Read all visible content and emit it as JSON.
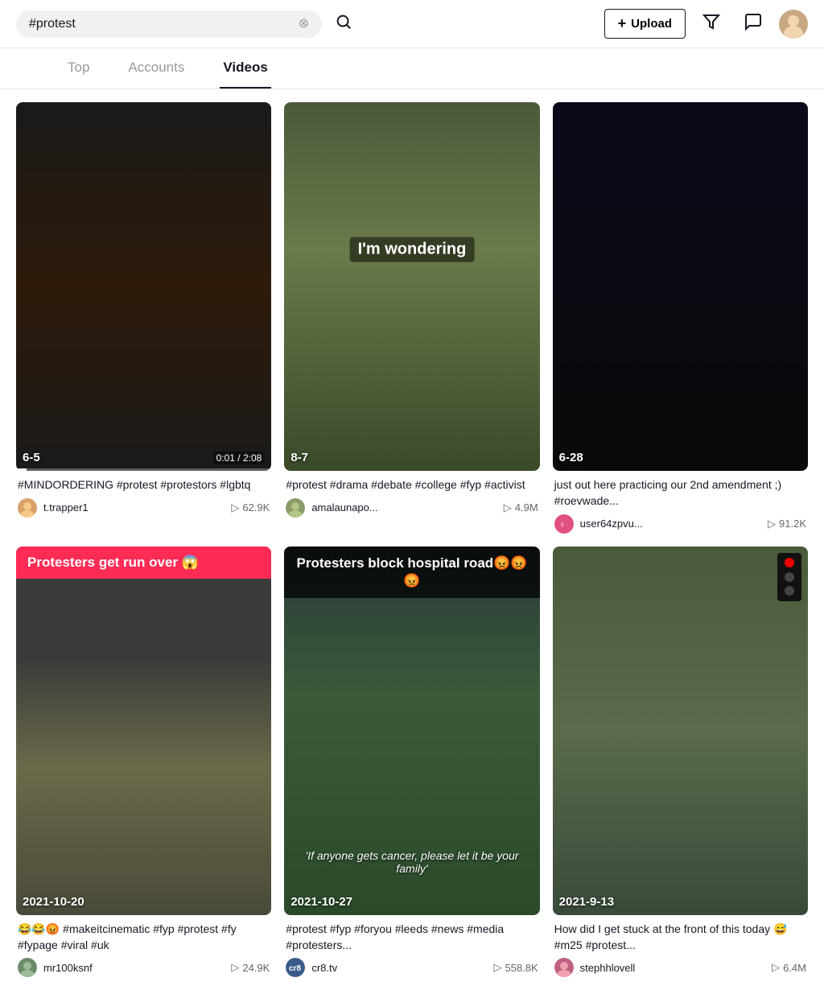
{
  "header": {
    "search_value": "#protest",
    "search_placeholder": "Search",
    "upload_label": "Upload",
    "clear_title": "Clear"
  },
  "tabs": [
    {
      "id": "top",
      "label": "Top",
      "active": false
    },
    {
      "id": "accounts",
      "label": "Accounts",
      "active": false
    },
    {
      "id": "videos",
      "label": "Videos",
      "active": true
    }
  ],
  "videos": [
    {
      "id": 1,
      "thumb_label": "6-5",
      "duration": "0:01 / 2:08",
      "title": "#MINDORDERING #protest #protestors #lgbtq",
      "username": "t.trapper1",
      "play_count": "62.9K",
      "type": "normal"
    },
    {
      "id": 2,
      "thumb_label": "8-7",
      "overlay_text": "I'm wondering",
      "title": "#protest #drama #debate #college #fyp #activist",
      "username": "amalaunapo...",
      "play_count": "4.9M",
      "type": "wondering"
    },
    {
      "id": 3,
      "thumb_label": "6-28",
      "title": "just out here practicing our 2nd amendment ;) #roevwade...",
      "username": "user64zpvu...",
      "play_count": "91.2K",
      "type": "dark"
    },
    {
      "id": 4,
      "red_banner": "Protesters get run over 😱",
      "date_label": "2021-10-20",
      "title": "😂😂😡 #makeitcinematic #fyp #protest #fy #fypage #viral #uk",
      "username": "mr100ksnf",
      "play_count": "24.9K",
      "type": "red_banner"
    },
    {
      "id": 5,
      "hospital_banner": "Protesters block hospital road😡😡😡",
      "date_label": "2021-10-27",
      "subtitle": "'If anyone gets cancer, please let it be your family'",
      "title": "#protest #fyp #foryou #leeds #news #media #protesters...",
      "username": "cr8.tv",
      "play_count": "558.8K",
      "type": "hospital"
    },
    {
      "id": 6,
      "date_label": "2021-9-13",
      "title": "How did I get stuck at the front of this today 😅 #m25 #protest...",
      "username": "stephhlovell",
      "play_count": "6.4M",
      "type": "road"
    }
  ]
}
